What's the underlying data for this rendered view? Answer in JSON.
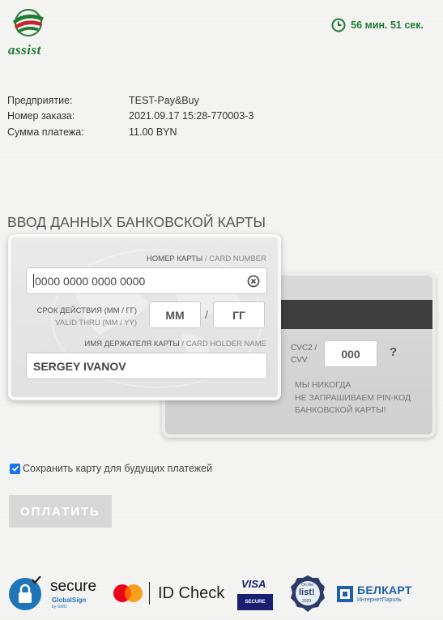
{
  "header": {
    "logo_text": "assist",
    "timer": "56 мин. 51 сек."
  },
  "order_info": [
    {
      "label": "Предприятие:",
      "value": "TEST-Pay&Buy"
    },
    {
      "label": "Номер заказа:",
      "value": "2021.09.17 15:28-770003-3"
    },
    {
      "label": "Сумма платежа:",
      "value": "11.00 BYN"
    }
  ],
  "section_title": "ВВОД ДАННЫХ БАНКОВСКОЙ КАРТЫ",
  "card_front": {
    "card_number_label_ru": "НОМЕР КАРТЫ",
    "card_number_label_en": "/ CARD NUMBER",
    "card_number_placeholder": "0000 0000 0000 0000",
    "expiry_label_ru": "СРОК ДЕЙСТВИЯ (ММ / ГГ)",
    "expiry_label_en": "VALID THRU (MM / YY)",
    "month_placeholder": "ММ",
    "year_placeholder": "ГГ",
    "slash": "/",
    "holder_label_ru": "ИМЯ ДЕРЖАТЕЛЯ КАРТЫ",
    "holder_label_en": "/ CARD HOLDER NAME",
    "holder_value": "SERGEY IVANOV"
  },
  "card_back": {
    "cvc_label_1": "CVC2 /",
    "cvc_label_2": "CVV",
    "cvc_placeholder": "000",
    "help": "?",
    "pin_note_1": "МЫ НИКОГДА",
    "pin_note_2": "НЕ ЗАПРАШИВАЕМ PIN-КОД",
    "pin_note_3": "БАНКОВСКОЙ КАРТЫ!"
  },
  "save_card": {
    "label": "Сохранить карту для будущих платежей",
    "checked": true
  },
  "pay_button": "ОПЛАТИТЬ",
  "footer": {
    "globalsign_title": "secure",
    "globalsign_sub": "GlobalSign",
    "globalsign_tiny": "by GMO",
    "mastercard_text": "ID Check",
    "visa_text": "VISA",
    "visa_sub": "SECURE",
    "list_top": "On the",
    "list_main": "list!",
    "list_year": "2020",
    "belkart_title": "БЕЛКАРТ",
    "belkart_sub": "ИнтернетПароль"
  },
  "colors": {
    "brand_green": "#1f7a33",
    "accent_red": "#c4262e",
    "button_disabled": "#d7d7d7"
  }
}
